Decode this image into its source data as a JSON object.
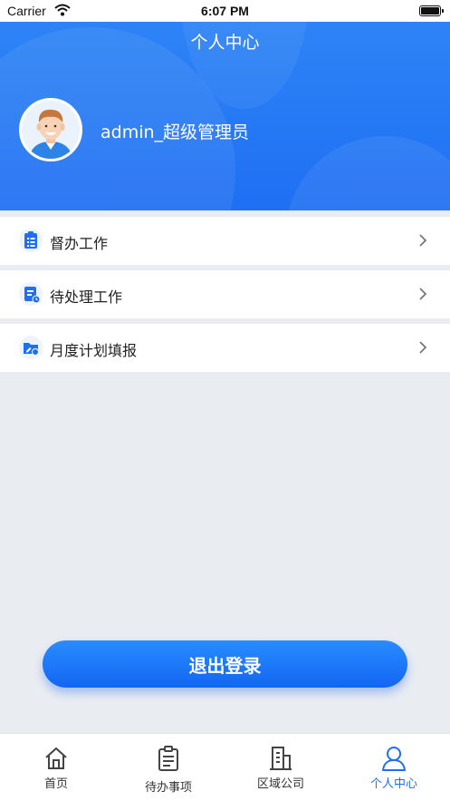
{
  "status_bar": {
    "carrier": "Carrier",
    "time": "6:07 PM"
  },
  "header": {
    "title": "个人中心",
    "user_name": "admin_超级管理员"
  },
  "menu": {
    "items": [
      {
        "label": "督办工作",
        "icon": "clipboard-list-icon"
      },
      {
        "label": "待处理工作",
        "icon": "document-clock-icon"
      },
      {
        "label": "月度计划填报",
        "icon": "folder-edit-icon"
      }
    ]
  },
  "actions": {
    "logout_label": "退出登录"
  },
  "tabbar": {
    "items": [
      {
        "label": "首页",
        "icon": "home-icon",
        "active": false
      },
      {
        "label": "待办事项",
        "icon": "clipboard-icon",
        "active": false
      },
      {
        "label": "区域公司",
        "icon": "building-icon",
        "active": false
      },
      {
        "label": "个人中心",
        "icon": "user-icon",
        "active": true
      }
    ]
  },
  "colors": {
    "brand_blue": "#1f6ff3",
    "header_gradient_top": "#2f86f6",
    "background": "#e9ecf1"
  }
}
